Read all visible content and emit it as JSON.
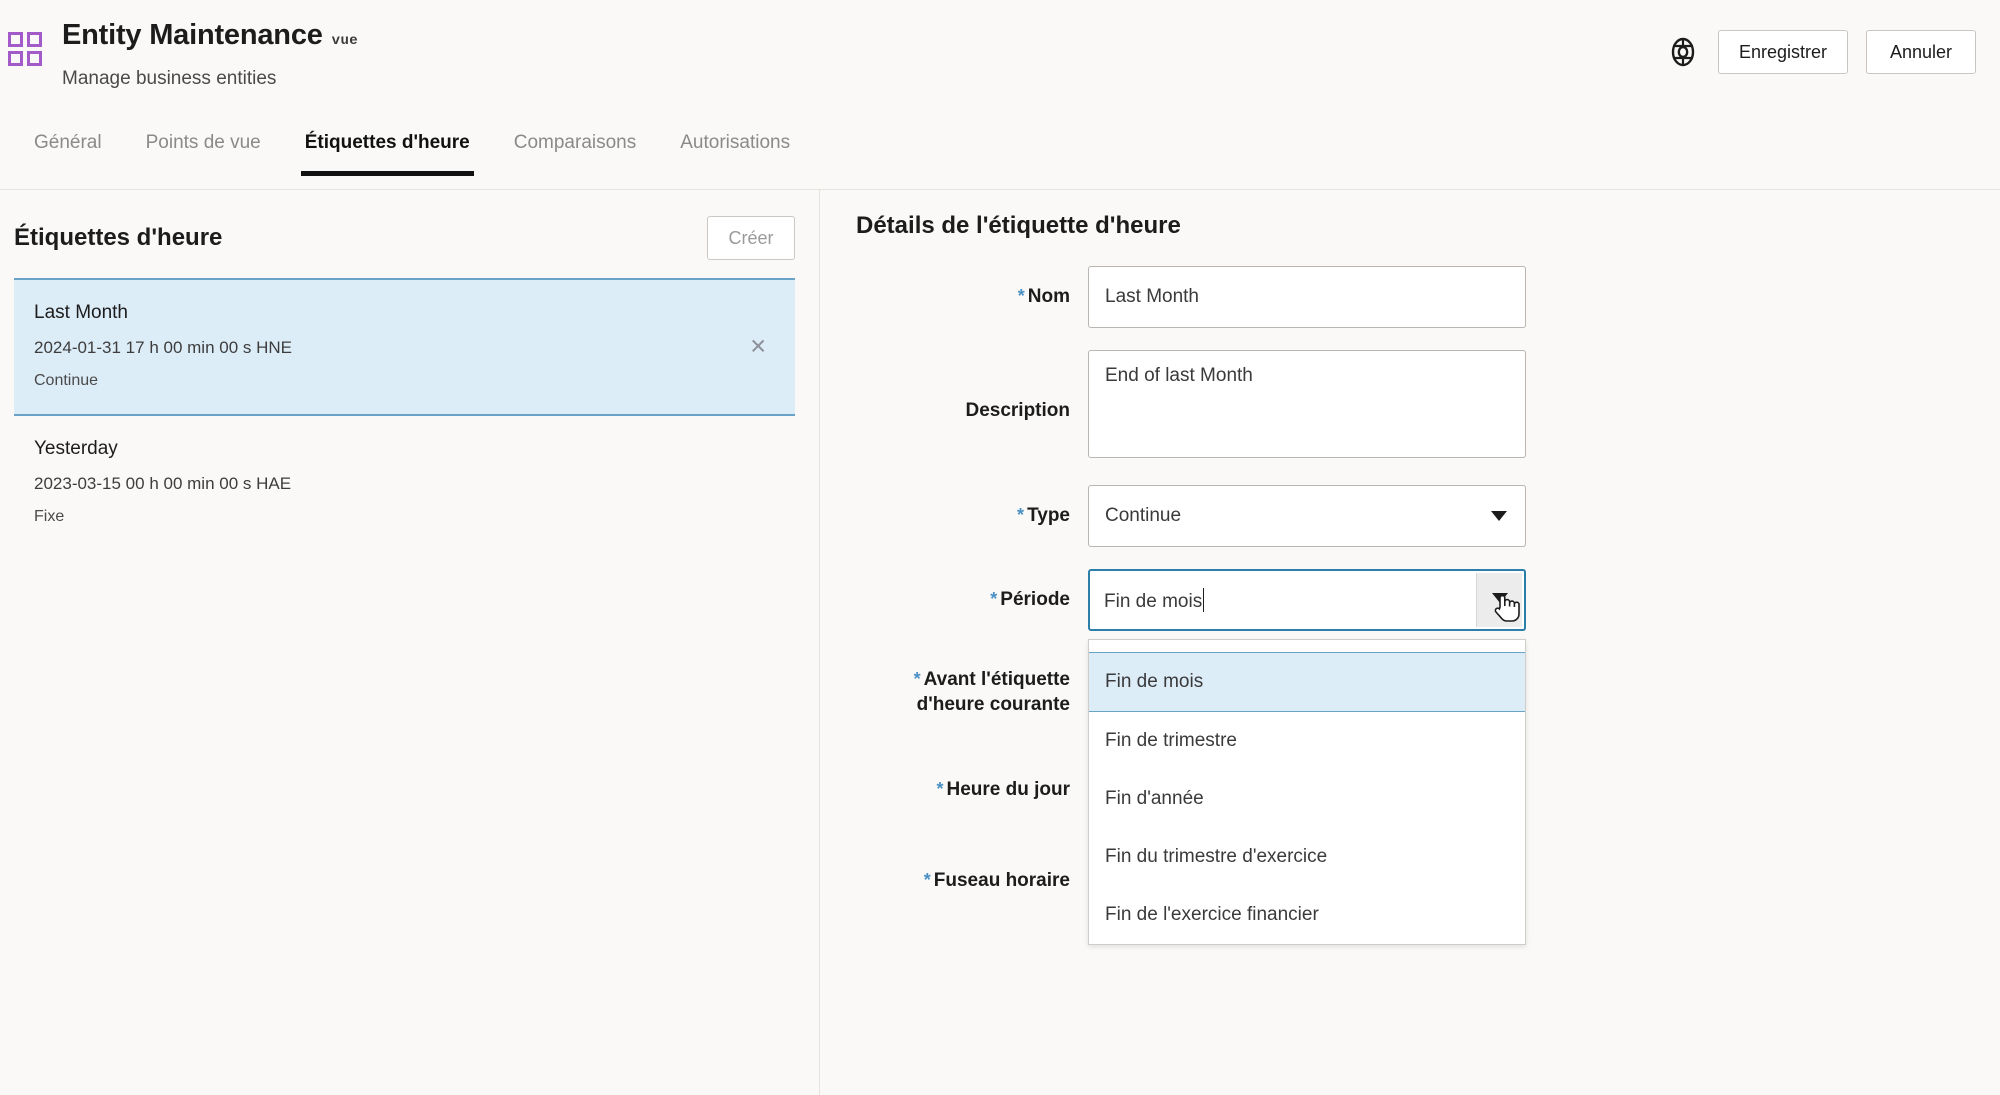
{
  "header": {
    "app_icon": "grid-squares-icon",
    "title": "Entity Maintenance",
    "badge": "vue",
    "subtitle": "Manage business entities",
    "settings_icon": "gear-icon",
    "save_label": "Enregistrer",
    "cancel_label": "Annuler",
    "accent_purple": "#a25bc8"
  },
  "tabs": [
    {
      "label": "Général",
      "active": false
    },
    {
      "label": "Points de vue",
      "active": false
    },
    {
      "label": "Étiquettes d'heure",
      "active": true
    },
    {
      "label": "Comparaisons",
      "active": false
    },
    {
      "label": "Autorisations",
      "active": false
    }
  ],
  "left_panel": {
    "title": "Étiquettes d'heure",
    "create_label": "Créer",
    "close_icon": "close-icon",
    "items": [
      {
        "name": "Last Month",
        "date": "2024-01-31 17 h 00 min 00 s HNE",
        "type": "Continue",
        "selected": true
      },
      {
        "name": "Yesterday",
        "date": "2023-03-15 00 h 00 min 00 s HAE",
        "type": "Fixe",
        "selected": false
      }
    ]
  },
  "details": {
    "title": "Détails de l'étiquette d'heure",
    "required_marker": "*",
    "fields": {
      "nom": {
        "label": "Nom",
        "value": "Last Month",
        "required": true
      },
      "description": {
        "label": "Description",
        "value": "End of last Month",
        "required": false
      },
      "type": {
        "label": "Type",
        "value": "Continue",
        "required": true
      },
      "periode": {
        "label": "Période",
        "value": "Fin de mois",
        "required": true
      },
      "avant": {
        "label_line1": "Avant l'étiquette",
        "label_line2": "d'heure courante",
        "required": true
      },
      "heure_du_jour": {
        "label": "Heure du jour",
        "required": true
      },
      "fuseau_horaire": {
        "label": "Fuseau horaire",
        "required": true
      }
    },
    "periode_dropdown": {
      "open": true,
      "options": [
        "Fin de mois",
        "Fin de trimestre",
        "Fin d'année",
        "Fin du trimestre d'exercice",
        "Fin de l'exercice financier"
      ],
      "highlighted": "Fin de mois"
    }
  },
  "colors": {
    "selection_blue": "#ddedf8",
    "selection_border": "#6aa3c8",
    "focus_border": "#2b7fa8",
    "required_asterisk": "#4a90c4",
    "page_bg": "#faf9f7"
  }
}
